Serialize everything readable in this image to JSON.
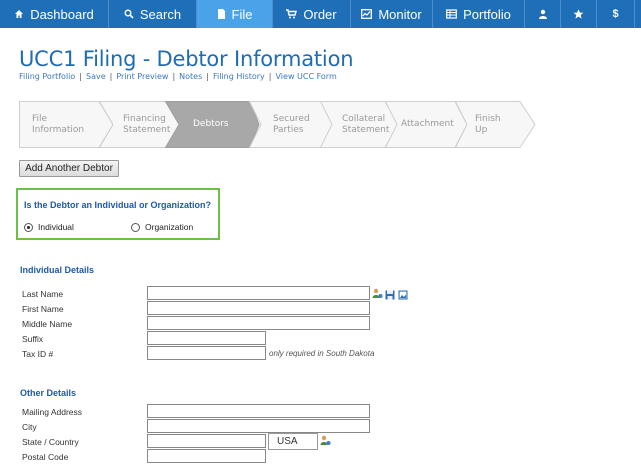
{
  "nav": {
    "items": [
      {
        "label": "Dashboard",
        "icon": "home-icon"
      },
      {
        "label": "Search",
        "icon": "search-icon"
      },
      {
        "label": "File",
        "icon": "file-icon"
      },
      {
        "label": "Order",
        "icon": "cart-icon"
      },
      {
        "label": "Monitor",
        "icon": "monitor-icon"
      },
      {
        "label": "Portfolio",
        "icon": "portfolio-icon"
      },
      {
        "label": "",
        "icon": "user-icon"
      },
      {
        "label": "",
        "icon": "star-icon"
      },
      {
        "label": "",
        "icon": "dollar-icon"
      }
    ],
    "active": "File",
    "colors": {
      "bar": "#1e6fb8",
      "active": "#4aa3e8"
    }
  },
  "header": {
    "title": "UCC1 Filing - Debtor Information",
    "links": [
      "Filing Portfolio",
      "Save",
      "Print Preview",
      "Notes",
      "Filing History",
      "View UCC Form"
    ]
  },
  "steps": [
    {
      "line1": "File",
      "line2": "Information"
    },
    {
      "line1": "Financing",
      "line2": "Statement"
    },
    {
      "line1": "Debtors",
      "line2": ""
    },
    {
      "line1": "Secured",
      "line2": "Parties"
    },
    {
      "line1": "Collateral",
      "line2": "Statement"
    },
    {
      "line1": "Attachment",
      "line2": ""
    },
    {
      "line1": "Finish Up",
      "line2": ""
    }
  ],
  "active_step": "Debtors",
  "add_debtor_label": "Add Another Debtor",
  "debtor_type": {
    "question": "Is the Debtor an Individual or Organization?",
    "options": [
      "Individual",
      "Organization"
    ],
    "selected": "Individual",
    "highlight_color": "#6bc144"
  },
  "individual": {
    "heading": "Individual Details",
    "fields": {
      "last_name": {
        "label": "Last Name",
        "value": ""
      },
      "first_name": {
        "label": "First Name",
        "value": ""
      },
      "middle_name": {
        "label": "Middle Name",
        "value": ""
      },
      "suffix": {
        "label": "Suffix",
        "value": ""
      },
      "tax_id": {
        "label": "Tax ID #",
        "value": ""
      }
    },
    "tax_note": "only required in South Dakota"
  },
  "other": {
    "heading": "Other Details",
    "fields": {
      "mailing_address": {
        "label": "Mailing Address",
        "value": ""
      },
      "city": {
        "label": "City",
        "value": ""
      },
      "state_country": {
        "label": "State / Country",
        "value": ""
      },
      "postal_code": {
        "label": "Postal Code",
        "value": ""
      }
    },
    "country": "USA"
  }
}
